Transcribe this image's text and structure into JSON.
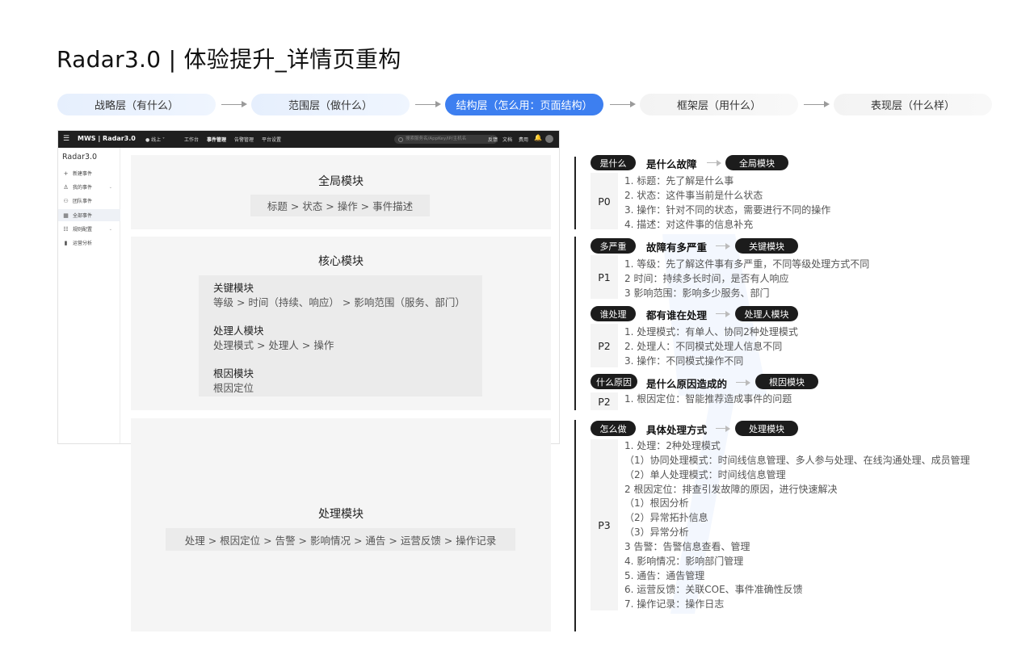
{
  "title": "Radar3.0 | 体验提升_详情页重构",
  "steps": [
    "战略层（有什么）",
    "范围层（做什么）",
    "结构层（怎么用：页面结构）",
    "框架层（用什么）",
    "表现层（什么样）"
  ],
  "colors": {
    "active_step": "#3d7ff0",
    "dark_tag": "#1c1c1c",
    "card_bg": "#f5f5f5"
  },
  "app": {
    "menu_icon": "☰",
    "brand": "MWS | Radar3.0",
    "env": "● 线上 ˅",
    "nav": [
      "工作台",
      "事件管理",
      "告警管理",
      "平台设置"
    ],
    "search_placeholder": "搜索服务名/AppKey/IP/主机名",
    "right_links": [
      "反馈",
      "文档",
      "费用"
    ],
    "bell_icon": "🔔",
    "sidebar_title": "Radar3.0",
    "sidebar": [
      {
        "icon": "+",
        "label": "新建事件"
      },
      {
        "icon": "♙",
        "label": "我的事件"
      },
      {
        "icon": "⚇",
        "label": "团队事件"
      },
      {
        "icon": "▦",
        "label": "全部事件"
      },
      {
        "icon": "☷",
        "label": "规则配置"
      },
      {
        "icon": "▮",
        "label": "运营分析"
      }
    ]
  },
  "modules": {
    "global": {
      "title": "全局模块",
      "flow": "标题 > 状态 > 操作 > 事件描述"
    },
    "core": {
      "title": "核心模块",
      "key_title": "关键模块",
      "key_flow": "等级 > 时间（持续、响应） > 影响范围（服务、部门）",
      "handler_title": "处理人模块",
      "handler_flow": "处理模式 > 处理人 > 操作",
      "root_title": "根因模块",
      "root_flow": "根因定位"
    },
    "process": {
      "title": "处理模块",
      "flow": "处理 > 根因定位 > 告警 > 影响情况 > 通告 > 运营反馈 > 操作记录"
    }
  },
  "groups": [
    {
      "q": "是什么",
      "question": "是什么故障",
      "module": "全局模块",
      "p": "P0",
      "items": [
        "1. 标题：先了解是什么事",
        "2. 状态：这件事当前是什么状态",
        "3. 操作：针对不同的状态，需要进行不同的操作",
        "4. 描述：对这件事的信息补充"
      ]
    },
    {
      "q": "多严重",
      "question": "故障有多严重",
      "module": "关键模块",
      "p": "P1",
      "items": [
        "1. 等级：先了解这件事有多严重，不同等级处理方式不同",
        "2 时间：持续多长时间，是否有人响应",
        "3 影响范围：影响多少服务、部门"
      ]
    },
    {
      "q": "谁处理",
      "question": "都有谁在处理",
      "module": "处理人模块",
      "p": "P2",
      "items": [
        "1. 处理模式：有单人、协同2种处理模式",
        "2. 处理人：不同模式处理人信息不同",
        "3. 操作：不同模式操作不同"
      ]
    },
    {
      "q": "什么原因",
      "question": "是什么原因造成的",
      "module": "根因模块",
      "p": "P2",
      "items": [
        "1. 根因定位：智能推荐造成事件的问题"
      ]
    },
    {
      "q": "怎么做",
      "question": "具体处理方式",
      "module": "处理模块",
      "p": "P3",
      "items": [
        "1. 处理：2种处理模式",
        "（1）协同处理模式：时间线信息管理、多人参与处理、在线沟通处理、成员管理",
        "（2）单人处理模式：时间线信息管理",
        "2 根因定位：排查引发故障的原因，进行快速解决",
        "（1）根因分析",
        "（2）异常拓扑信息",
        "（3）异常分析",
        "3 告警：告警信息查看、管理",
        "4. 影响情况：影响部门管理",
        "5. 通告：通告管理",
        "6. 运营反馈：关联COE、事件准确性反馈",
        "7. 操作记录：操作日志"
      ]
    }
  ]
}
